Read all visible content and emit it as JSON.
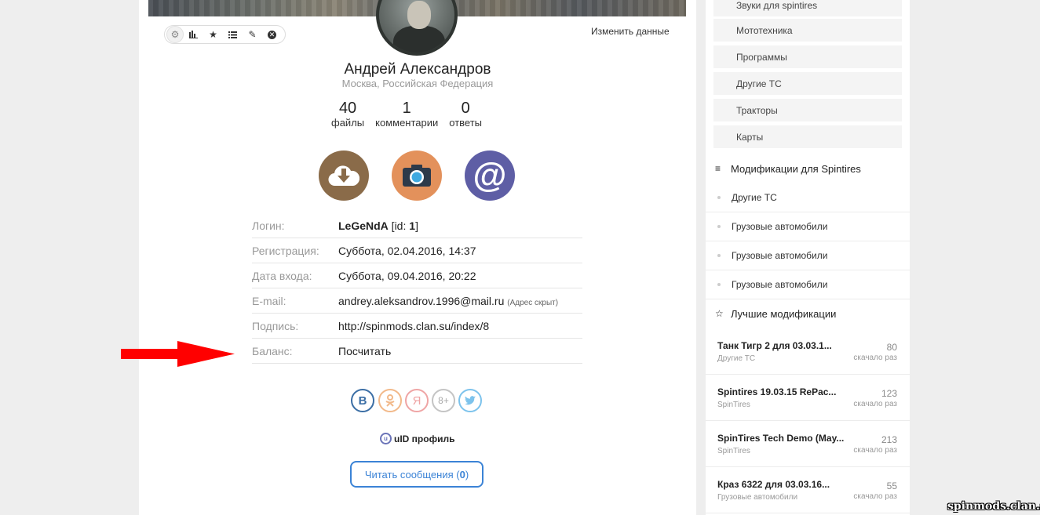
{
  "profile": {
    "edit_label": "Изменить данные",
    "name": "Андрей Александров",
    "location": "Москва, Российская Федерация",
    "stats": [
      {
        "num": "40",
        "label": "файлы"
      },
      {
        "num": "1",
        "label": "комментарии"
      },
      {
        "num": "0",
        "label": "ответы"
      }
    ],
    "info": {
      "login_label": "Логин:",
      "login_value": "LeGeNdA",
      "login_id_prefix": " [id: ",
      "login_id": "1",
      "login_id_suffix": "]",
      "reg_label": "Регистрация:",
      "reg_value": "Суббота, 02.04.2016, 14:37",
      "last_label": "Дата входа:",
      "last_value": "Суббота, 09.04.2016, 20:22",
      "email_label": "E-mail:",
      "email_value": "andrey.aleksandrov.1996@mail.ru",
      "email_note": "(Адрес скрыт)",
      "sign_label": "Подпись:",
      "sign_value": "http://spinmods.clan.su/index/8",
      "balance_label": "Баланс:",
      "balance_value": "Посчитать"
    },
    "social": {
      "vk": "B",
      "ok": "ok-icon",
      "ya": "Я",
      "gp": "8+",
      "tw": "twitter-icon"
    },
    "uid_label": "uID профиль",
    "messages_label": "Читать сообщения (",
    "messages_count": "0",
    "messages_suffix": ")"
  },
  "colors": {
    "download": "#8a6b49",
    "camera": "#e3915b",
    "at": "#5e5ea5",
    "arrow": "#ff0000",
    "button": "#3b83d6"
  },
  "sidebar": {
    "categories": [
      "Звуки для spintires",
      "Мототехника",
      "Программы",
      "Другие ТС",
      "Тракторы",
      "Карты"
    ],
    "mods_title": "Модификации для Spintires",
    "mods": [
      "Другие ТС",
      "Грузовые автомобили",
      "Грузовые автомобили",
      "Грузовые автомобили"
    ],
    "best_title": "Лучшие модификации",
    "best": [
      {
        "title": "Танк Тигр 2 для 03.03.1...",
        "cat": "Другие ТС",
        "num": "80",
        "unit": "скачало раз"
      },
      {
        "title": "Spintires 19.03.15 RePac...",
        "cat": "SpinTires",
        "num": "123",
        "unit": "скачало раз"
      },
      {
        "title": "SpinTires Tech Demo (May...",
        "cat": "SpinTires",
        "num": "213",
        "unit": "скачало раз"
      },
      {
        "title": "Краз 6322 для 03.03.16...",
        "cat": "Грузовые автомобили",
        "num": "55",
        "unit": "скачало раз"
      }
    ]
  },
  "watermark": "spinmods.clan.su"
}
